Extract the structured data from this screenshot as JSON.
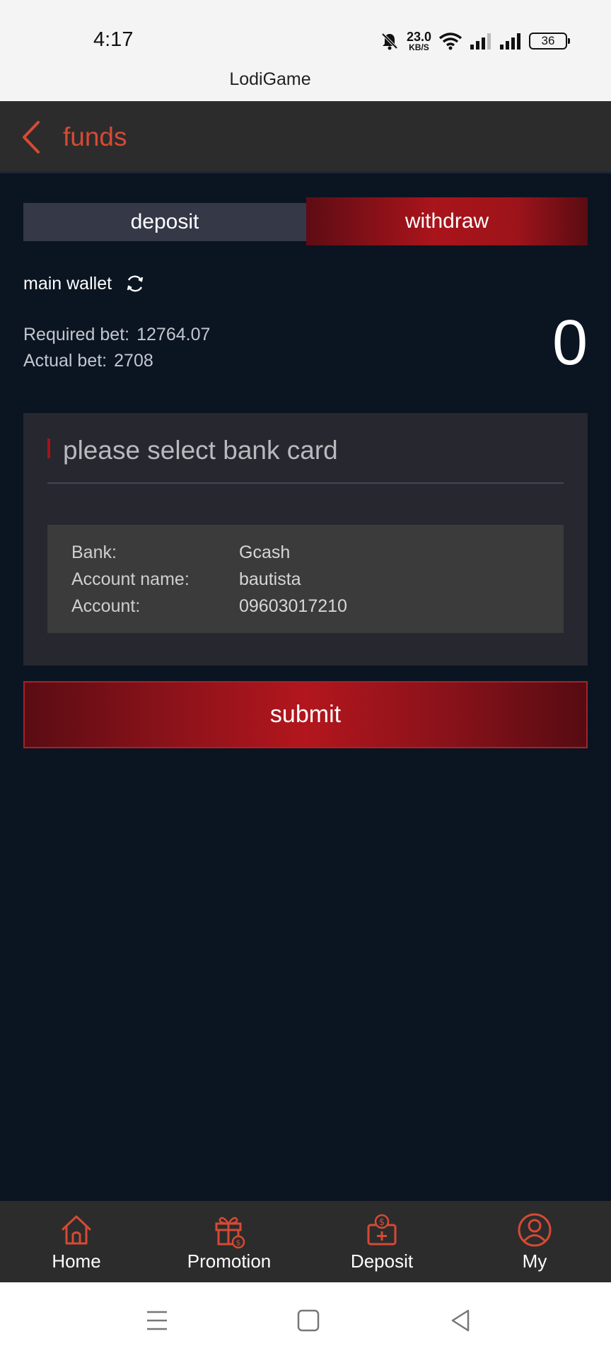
{
  "status_bar": {
    "time": "4:17",
    "net_speed_value": "23.0",
    "net_speed_unit": "KB/S",
    "battery": "36"
  },
  "app_name": "LodiGame",
  "header": {
    "title": "funds"
  },
  "tabs": [
    {
      "label": "deposit",
      "active": false
    },
    {
      "label": "withdraw",
      "active": true
    }
  ],
  "wallet": {
    "label": "main wallet",
    "required_bet_label": "Required bet:",
    "required_bet_value": "12764.07",
    "actual_bet_label": "Actual bet:",
    "actual_bet_value": "2708",
    "balance": "0"
  },
  "bank_card": {
    "placeholder": "please select bank card",
    "details": [
      {
        "key": "Bank:",
        "value": "Gcash"
      },
      {
        "key": "Account name:",
        "value": "bautista"
      },
      {
        "key": "Account:",
        "value": "09603017210"
      }
    ]
  },
  "submit_label": "submit",
  "bottom_nav": [
    {
      "label": "Home",
      "icon": "home-icon"
    },
    {
      "label": "Promotion",
      "icon": "gift-icon"
    },
    {
      "label": "Deposit",
      "icon": "deposit-icon"
    },
    {
      "label": "My",
      "icon": "user-icon"
    }
  ],
  "colors": {
    "accent": "#d64a34",
    "primary_red": "#aa141b",
    "background": "#0b1521",
    "panel": "#26272f"
  }
}
